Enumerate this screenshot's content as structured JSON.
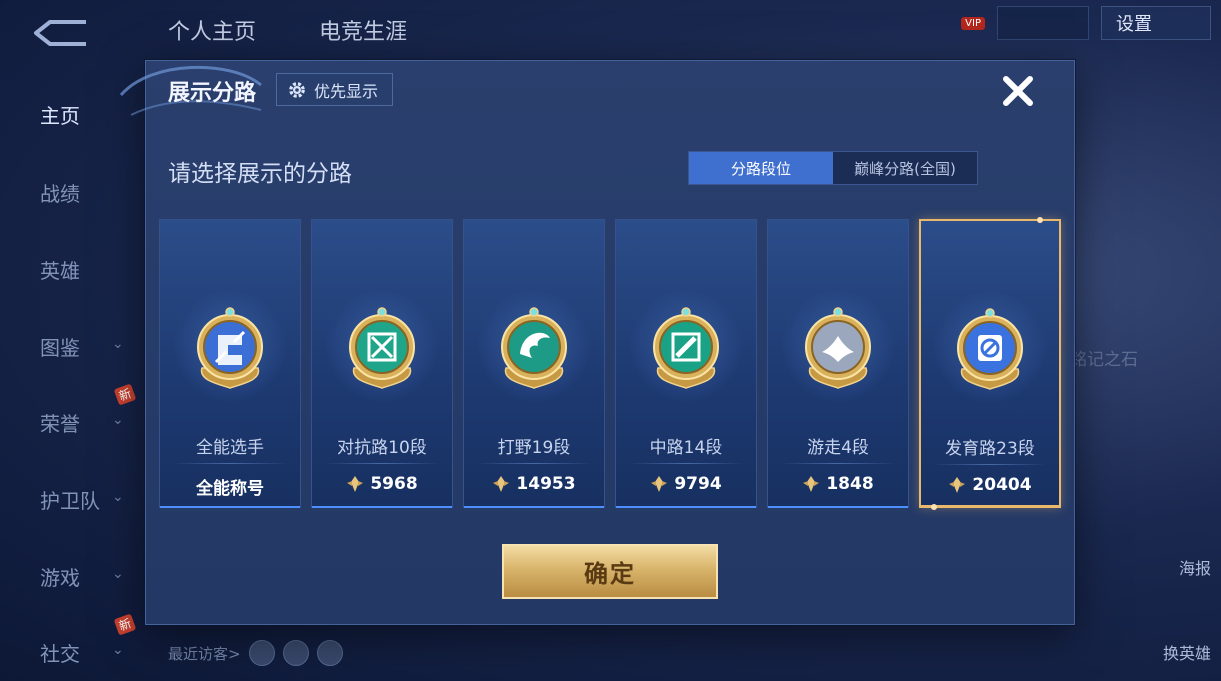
{
  "top_tabs": [
    "个人主页",
    "电竞生涯"
  ],
  "top_right": {
    "settings_label": "设置",
    "vip_label": "VIP"
  },
  "sidebar": {
    "items": [
      {
        "label": "主页",
        "active": true,
        "chevron": false,
        "new": false
      },
      {
        "label": "战绩",
        "active": false,
        "chevron": false,
        "new": false
      },
      {
        "label": "英雄",
        "active": false,
        "chevron": false,
        "new": false
      },
      {
        "label": "图鉴",
        "active": false,
        "chevron": true,
        "new": false
      },
      {
        "label": "荣誉",
        "active": false,
        "chevron": true,
        "new": true
      },
      {
        "label": "护卫队",
        "active": false,
        "chevron": true,
        "new": false
      },
      {
        "label": "游戏",
        "active": false,
        "chevron": true,
        "new": false
      },
      {
        "label": "社交",
        "active": false,
        "chevron": true,
        "new": true
      }
    ],
    "new_badge": "新"
  },
  "background": {
    "stone_text": "铭记之石",
    "poster_label": "海报",
    "swap_hero_label": "换英雄",
    "recent_visitors_label": "最近访客>"
  },
  "modal": {
    "title": "展示分路",
    "priority_button_label": "优先显示",
    "subtitle": "请选择展示的分路",
    "segments": [
      {
        "label": "分路段位",
        "active": true
      },
      {
        "label": "巅峰分路(全国)",
        "active": false
      }
    ],
    "cards": [
      {
        "lane": "全能选手",
        "score": "全能称号",
        "has_points_icon": false,
        "emblem": "all-round-emblem-icon",
        "color": "#3b6fd6",
        "selected": false
      },
      {
        "lane": "对抗路10段",
        "score": "5968",
        "has_points_icon": true,
        "emblem": "clash-lane-emblem-icon",
        "color": "#1fa58a",
        "selected": false
      },
      {
        "lane": "打野19段",
        "score": "14953",
        "has_points_icon": true,
        "emblem": "jungle-emblem-icon",
        "color": "#1d9b86",
        "selected": false
      },
      {
        "lane": "中路14段",
        "score": "9794",
        "has_points_icon": true,
        "emblem": "mid-lane-emblem-icon",
        "color": "#19a286",
        "selected": false
      },
      {
        "lane": "游走4段",
        "score": "1848",
        "has_points_icon": true,
        "emblem": "roam-emblem-icon",
        "color": "#9aa7bd",
        "selected": false
      },
      {
        "lane": "发育路23段",
        "score": "20404",
        "has_points_icon": true,
        "emblem": "farm-lane-emblem-icon",
        "color": "#3a72e0",
        "selected": true
      }
    ],
    "confirm_label": "确定"
  },
  "colors": {
    "accent_blue": "#3f6fcf",
    "selected_gold": "#e9b86d",
    "confirm_gold": "#d8b46b"
  }
}
